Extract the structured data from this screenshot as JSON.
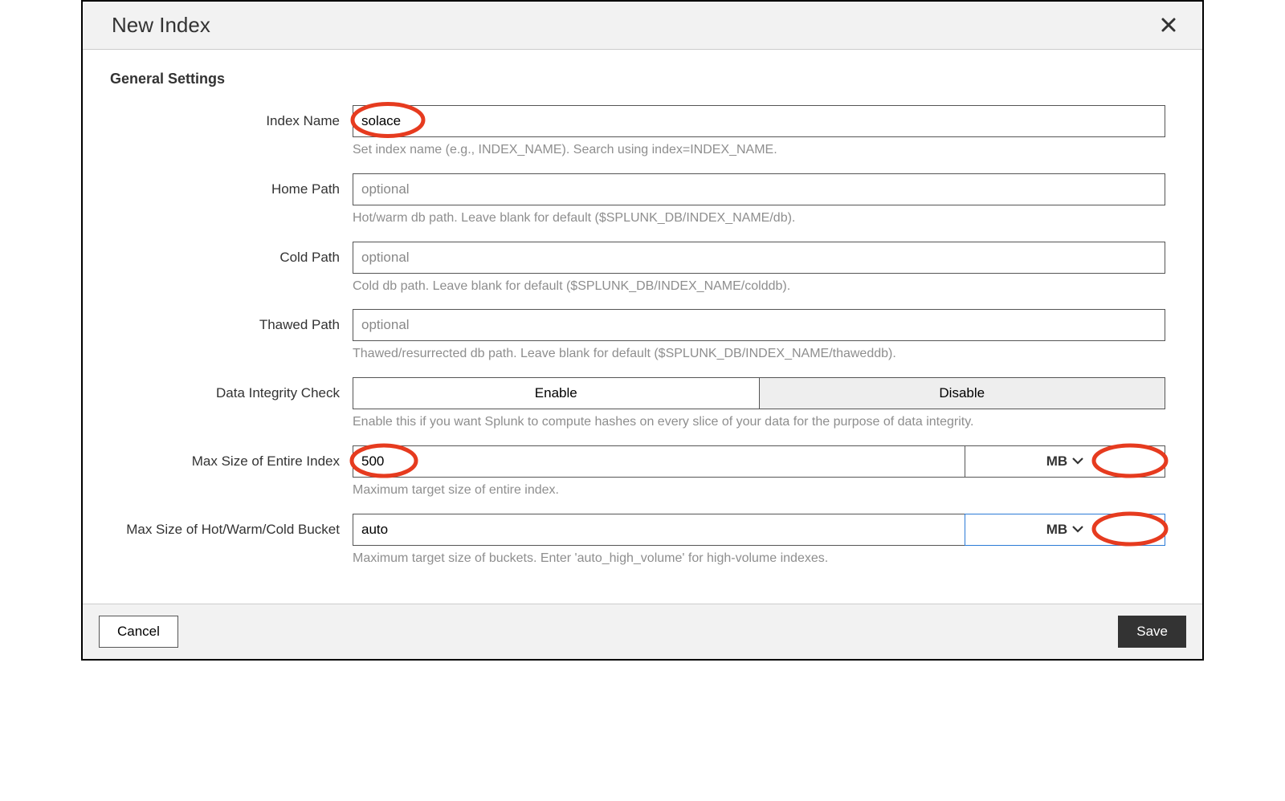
{
  "modal": {
    "title": "New Index"
  },
  "section": {
    "general": "General Settings"
  },
  "fields": {
    "index_name": {
      "label": "Index Name",
      "value": "solace",
      "help": "Set index name (e.g., INDEX_NAME). Search using index=INDEX_NAME."
    },
    "home_path": {
      "label": "Home Path",
      "placeholder": "optional",
      "help": "Hot/warm db path. Leave blank for default ($SPLUNK_DB/INDEX_NAME/db)."
    },
    "cold_path": {
      "label": "Cold Path",
      "placeholder": "optional",
      "help": "Cold db path. Leave blank for default ($SPLUNK_DB/INDEX_NAME/colddb)."
    },
    "thawed_path": {
      "label": "Thawed Path",
      "placeholder": "optional",
      "help": "Thawed/resurrected db path. Leave blank for default ($SPLUNK_DB/INDEX_NAME/thaweddb)."
    },
    "integrity": {
      "label": "Data Integrity Check",
      "enable": "Enable",
      "disable": "Disable",
      "help": "Enable this if you want Splunk to compute hashes on every slice of your data for the purpose of data integrity."
    },
    "max_index": {
      "label": "Max Size of Entire Index",
      "value": "500",
      "unit": "MB",
      "help": "Maximum target size of entire index."
    },
    "max_bucket": {
      "label": "Max Size of Hot/Warm/Cold Bucket",
      "value": "auto",
      "unit": "MB",
      "help": "Maximum target size of buckets. Enter 'auto_high_volume' for high-volume indexes."
    }
  },
  "footer": {
    "cancel": "Cancel",
    "save": "Save"
  }
}
